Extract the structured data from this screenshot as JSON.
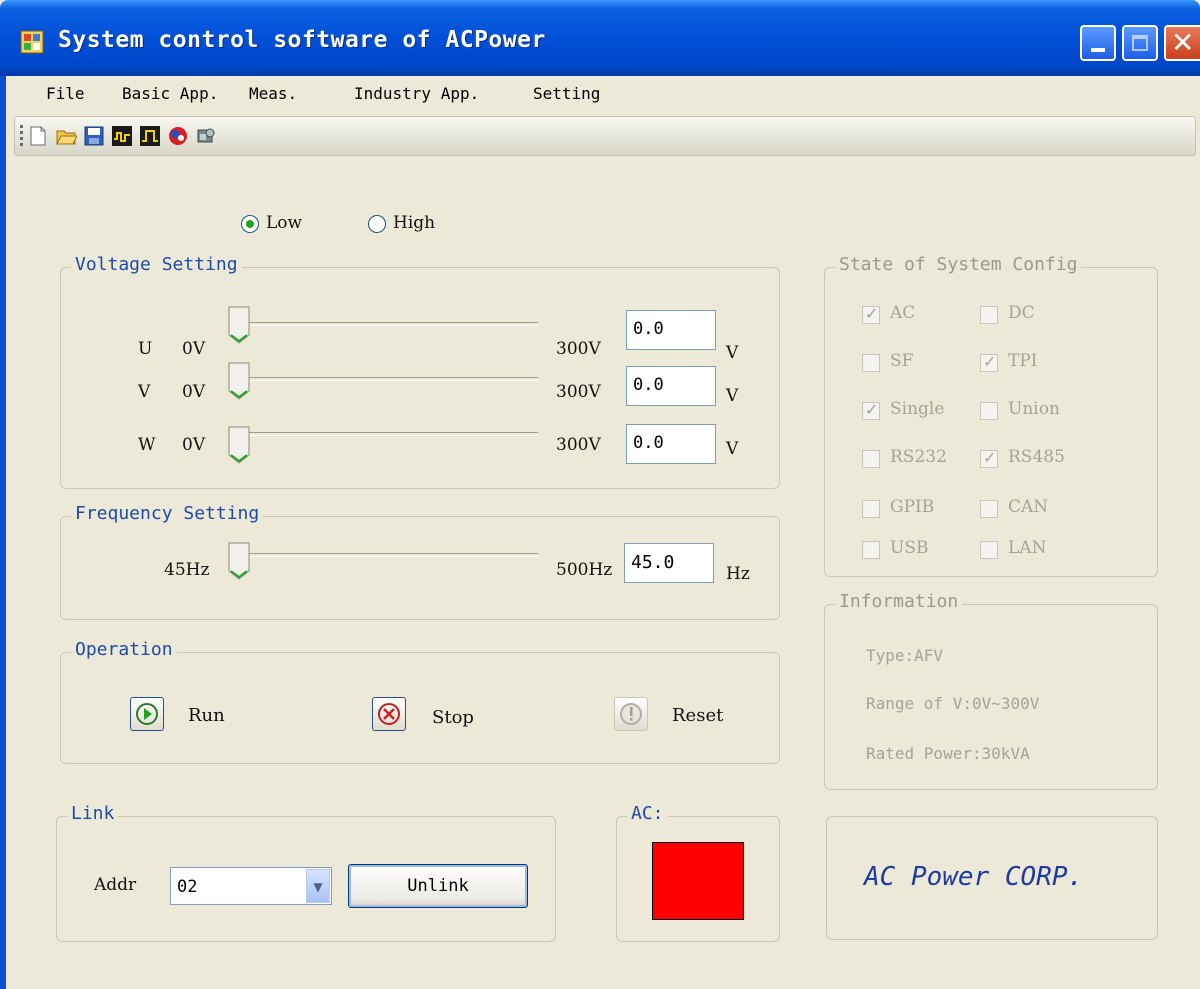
{
  "window": {
    "title": "System control software of ACPower"
  },
  "menu": {
    "items": [
      "File",
      "Basic App.",
      "Meas.",
      "Industry App.",
      "Setting"
    ]
  },
  "toolbar": {
    "icons": [
      "new-file-icon",
      "open-folder-icon",
      "save-icon",
      "waveform-icon",
      "pulse-icon",
      "network-icon",
      "tool-icon"
    ]
  },
  "range": {
    "low": "Low",
    "high": "High",
    "selected": "Low"
  },
  "voltage": {
    "title": "Voltage Setting",
    "unit": "V",
    "phases": [
      {
        "name": "U",
        "min": "0V",
        "max": "300V",
        "value": "0.0",
        "unit": "V"
      },
      {
        "name": "V",
        "min": "0V",
        "max": "300V",
        "value": "0.0",
        "unit": "V"
      },
      {
        "name": "W",
        "min": "0V",
        "max": "300V",
        "value": "0.0",
        "unit": "V"
      }
    ]
  },
  "frequency": {
    "title": "Frequency Setting",
    "min": "45Hz",
    "max": "500Hz",
    "value": "45.0",
    "unit": "Hz"
  },
  "operation": {
    "title": "Operation",
    "run": "Run",
    "stop": "Stop",
    "reset": "Reset"
  },
  "link": {
    "title": "Link",
    "addr_label": "Addr",
    "addr_value": "02",
    "unlink": "Unlink"
  },
  "ac": {
    "title": "AC:",
    "color": "#ff0000"
  },
  "system_config": {
    "title": "State of System Config",
    "items": [
      {
        "label": "AC",
        "checked": true
      },
      {
        "label": "DC",
        "checked": false
      },
      {
        "label": "SF",
        "checked": false
      },
      {
        "label": "TPI",
        "checked": true
      },
      {
        "label": "Single",
        "checked": true
      },
      {
        "label": "Union",
        "checked": false
      },
      {
        "label": "RS232",
        "checked": false
      },
      {
        "label": "RS485",
        "checked": true
      },
      {
        "label": "GPIB",
        "checked": false
      },
      {
        "label": "CAN",
        "checked": false
      },
      {
        "label": "USB",
        "checked": false
      },
      {
        "label": "LAN",
        "checked": false
      }
    ]
  },
  "information": {
    "title": "Information",
    "type": "Type:AFV",
    "range": "Range of V:0V~300V",
    "rated": "Rated Power:30kVA"
  },
  "brand": {
    "text": "AC Power CORP."
  }
}
